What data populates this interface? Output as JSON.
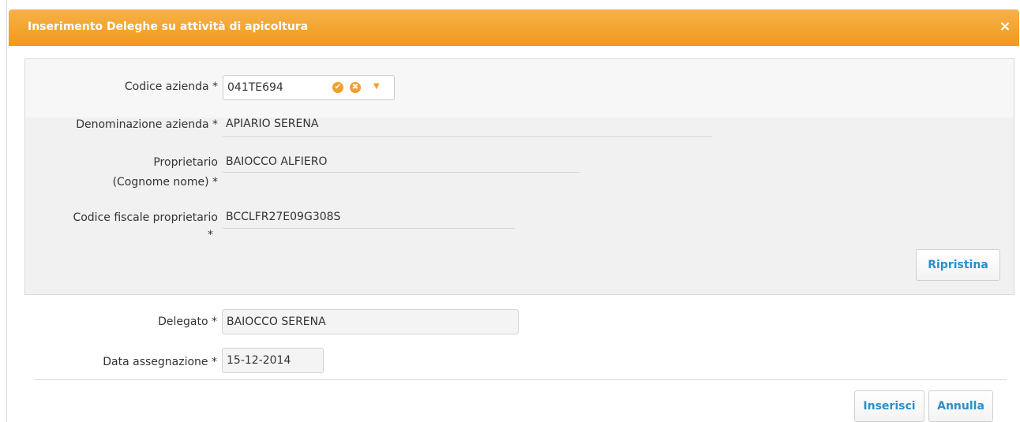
{
  "dialog": {
    "title": "Inserimento Deleghe su attività di apicoltura",
    "close_glyph": "×"
  },
  "form": {
    "codice_azienda": {
      "label": "Codice azienda *",
      "value": "041TE694",
      "confirm_icon": "✔",
      "clear_icon": "✖",
      "dropdown_icon": "▼"
    },
    "denominazione": {
      "label": "Denominazione azienda *",
      "value": "APIARIO SERENA"
    },
    "proprietario": {
      "label_line1": "Proprietario",
      "label_line2": "(Cognome nome) *",
      "value": "BAIOCCO ALFIERO"
    },
    "codice_fiscale": {
      "label_line1": "Codice fiscale proprietario",
      "label_line2": "*",
      "value": "BCCLFR27E09G308S"
    },
    "ripristina_label": "Ripristina",
    "delegato": {
      "label": "Delegato *",
      "value": "BAIOCCO SERENA"
    },
    "data_assegnazione": {
      "label": "Data assegnazione *",
      "value": "15-12-2014"
    }
  },
  "footer": {
    "inserisci_label": "Inserisci",
    "annulla_label": "Annulla"
  },
  "colors": {
    "header": "#f19a1c",
    "link_button_text": "#2a8fc9"
  }
}
